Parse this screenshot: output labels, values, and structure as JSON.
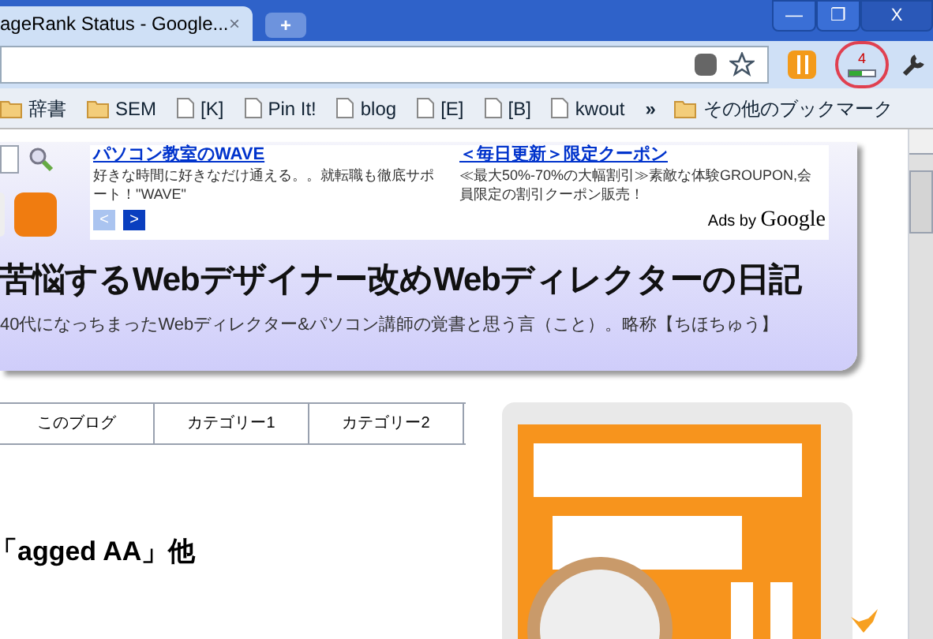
{
  "tab": {
    "title": "ageRank Status - Google...",
    "close": "×",
    "new_tab": "+"
  },
  "window_controls": [
    "—",
    "❐",
    "X"
  ],
  "toolbar": {
    "pagerank": "4",
    "level": 0.5
  },
  "bookmarks": [
    {
      "label": "辞書",
      "kind": "folder"
    },
    {
      "label": "SEM",
      "kind": "folder"
    },
    {
      "label": "[K]",
      "kind": "page"
    },
    {
      "label": "Pin It!",
      "kind": "page"
    },
    {
      "label": "blog",
      "kind": "page"
    },
    {
      "label": "[E]",
      "kind": "page"
    },
    {
      "label": "[B]",
      "kind": "page"
    },
    {
      "label": "kwout",
      "kind": "page"
    }
  ],
  "more": "»",
  "other_bookmarks": "その他のブックマーク",
  "ads": [
    {
      "title": "パソコン教室のWAVE",
      "body": "好きな時間に好きなだけ通える。。就転職も徹底サポート！\"WAVE\""
    },
    {
      "title": "＜毎日更新＞限定クーポン",
      "body": "≪最大50%-70%の大幅割引≫素敵な体験GROUPON,会員限定の割引クーポン販売！"
    }
  ],
  "ads_prev": "<",
  "ads_next": ">",
  "ads_by": "Ads by",
  "ads_brand": "Google",
  "blog_title": "苦悩するWebデザイナー改めWebディレクターの日記",
  "blog_subtitle": "40代になっちまったWebディレクター&パソコン講師の覚書と思う言（こと）。略称【ちほちゅう】",
  "nav": [
    "このブログ",
    "カテゴリー1",
    "カテゴリー2"
  ],
  "heading": "「agged AA」他"
}
